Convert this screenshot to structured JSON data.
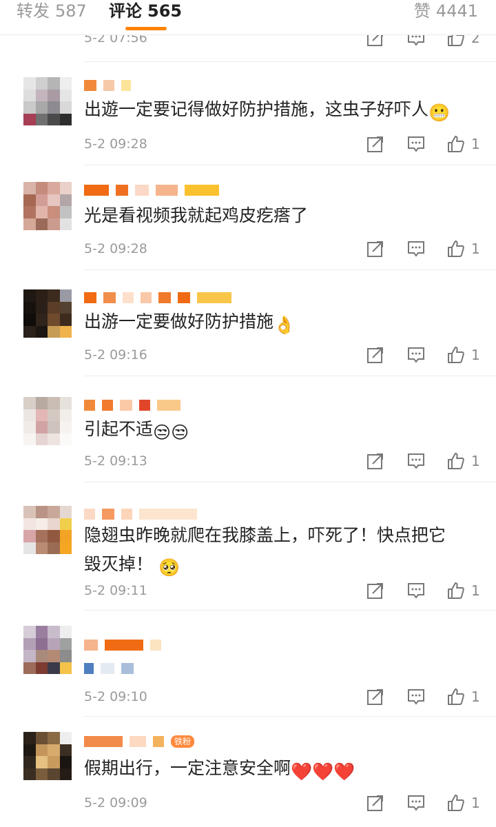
{
  "tabs": [
    {
      "label": "转发",
      "count": "587"
    },
    {
      "label": "评论",
      "count": "565"
    },
    {
      "label": "赞",
      "count": "4441"
    }
  ],
  "top_partial": {
    "time": "5-2 07:56",
    "likes": "2"
  },
  "comments": [
    {
      "text": "出遊一定要记得做好防护措施，这虫子好吓人",
      "emoji": "😬",
      "time": "5-2 09:28",
      "likes": "1"
    },
    {
      "text": "光是看视频我就起鸡皮疙瘩了",
      "time": "5-2 09:28",
      "likes": "1"
    },
    {
      "text": "出游一定要做好防护措施",
      "emoji": "👌",
      "time": "5-2 09:16",
      "likes": "1"
    },
    {
      "text": "引起不适",
      "emoji": "😒😒",
      "time": "5-2 09:13",
      "likes": "1"
    },
    {
      "text_line1": "隐翅虫昨晚就爬在我膝盖上，吓死了！快点把它",
      "text_line2": "毁灭掉！",
      "emoji": "🥺",
      "time": "5-2 09:11",
      "likes": "1"
    },
    {
      "time": "5-2 09:10",
      "likes": "1"
    },
    {
      "badge": "铁粉",
      "text": "假期出行，一定注意安全啊",
      "emoji": "❤️❤️❤️",
      "time": "5-2 09:09",
      "likes": "1"
    }
  ],
  "icons": [
    "share-icon",
    "reply-icon",
    "like-icon"
  ],
  "colors": {
    "accent": "#ff8200",
    "muted": "#9a9a9a",
    "text": "#222222"
  }
}
